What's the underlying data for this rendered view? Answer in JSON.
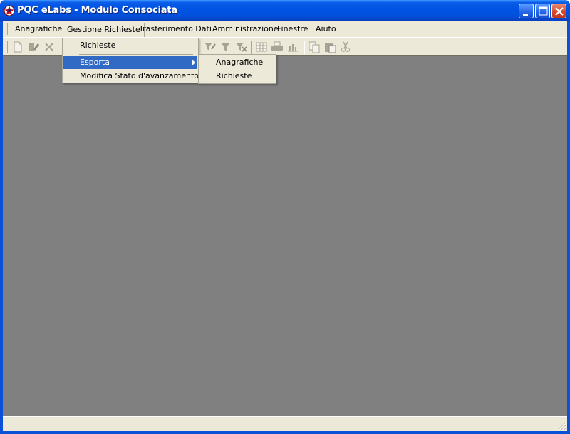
{
  "window": {
    "title": "PQC eLabs - Modulo Consociata"
  },
  "menubar": {
    "items": [
      {
        "label": "Anagrafiche"
      },
      {
        "label": "Gestione Richieste"
      },
      {
        "label": "Trasferimento Dati"
      },
      {
        "label": "Amministrazione"
      },
      {
        "label": "Finestre"
      },
      {
        "label": "Aiuto"
      }
    ]
  },
  "dropdown": {
    "items": [
      {
        "label": "Richieste"
      },
      {
        "label": "Esporta"
      },
      {
        "label": "Modifica Stato d'avanzamento"
      }
    ]
  },
  "submenu": {
    "items": [
      {
        "label": "Anagrafiche"
      },
      {
        "label": "Richieste"
      }
    ]
  },
  "toolbar": {
    "icons": [
      "new-document-icon",
      "edit-icon",
      "delete-icon",
      "filter-edit-icon",
      "filter-icon",
      "filter-remove-icon",
      "grid-icon",
      "print-icon",
      "chart-icon",
      "copy-icon",
      "paste-icon",
      "cut-icon"
    ]
  },
  "colors": {
    "titlebar": "#0054e3",
    "menu_highlight": "#316ac5",
    "mdi_background": "#808080",
    "face": "#ece9d8"
  }
}
